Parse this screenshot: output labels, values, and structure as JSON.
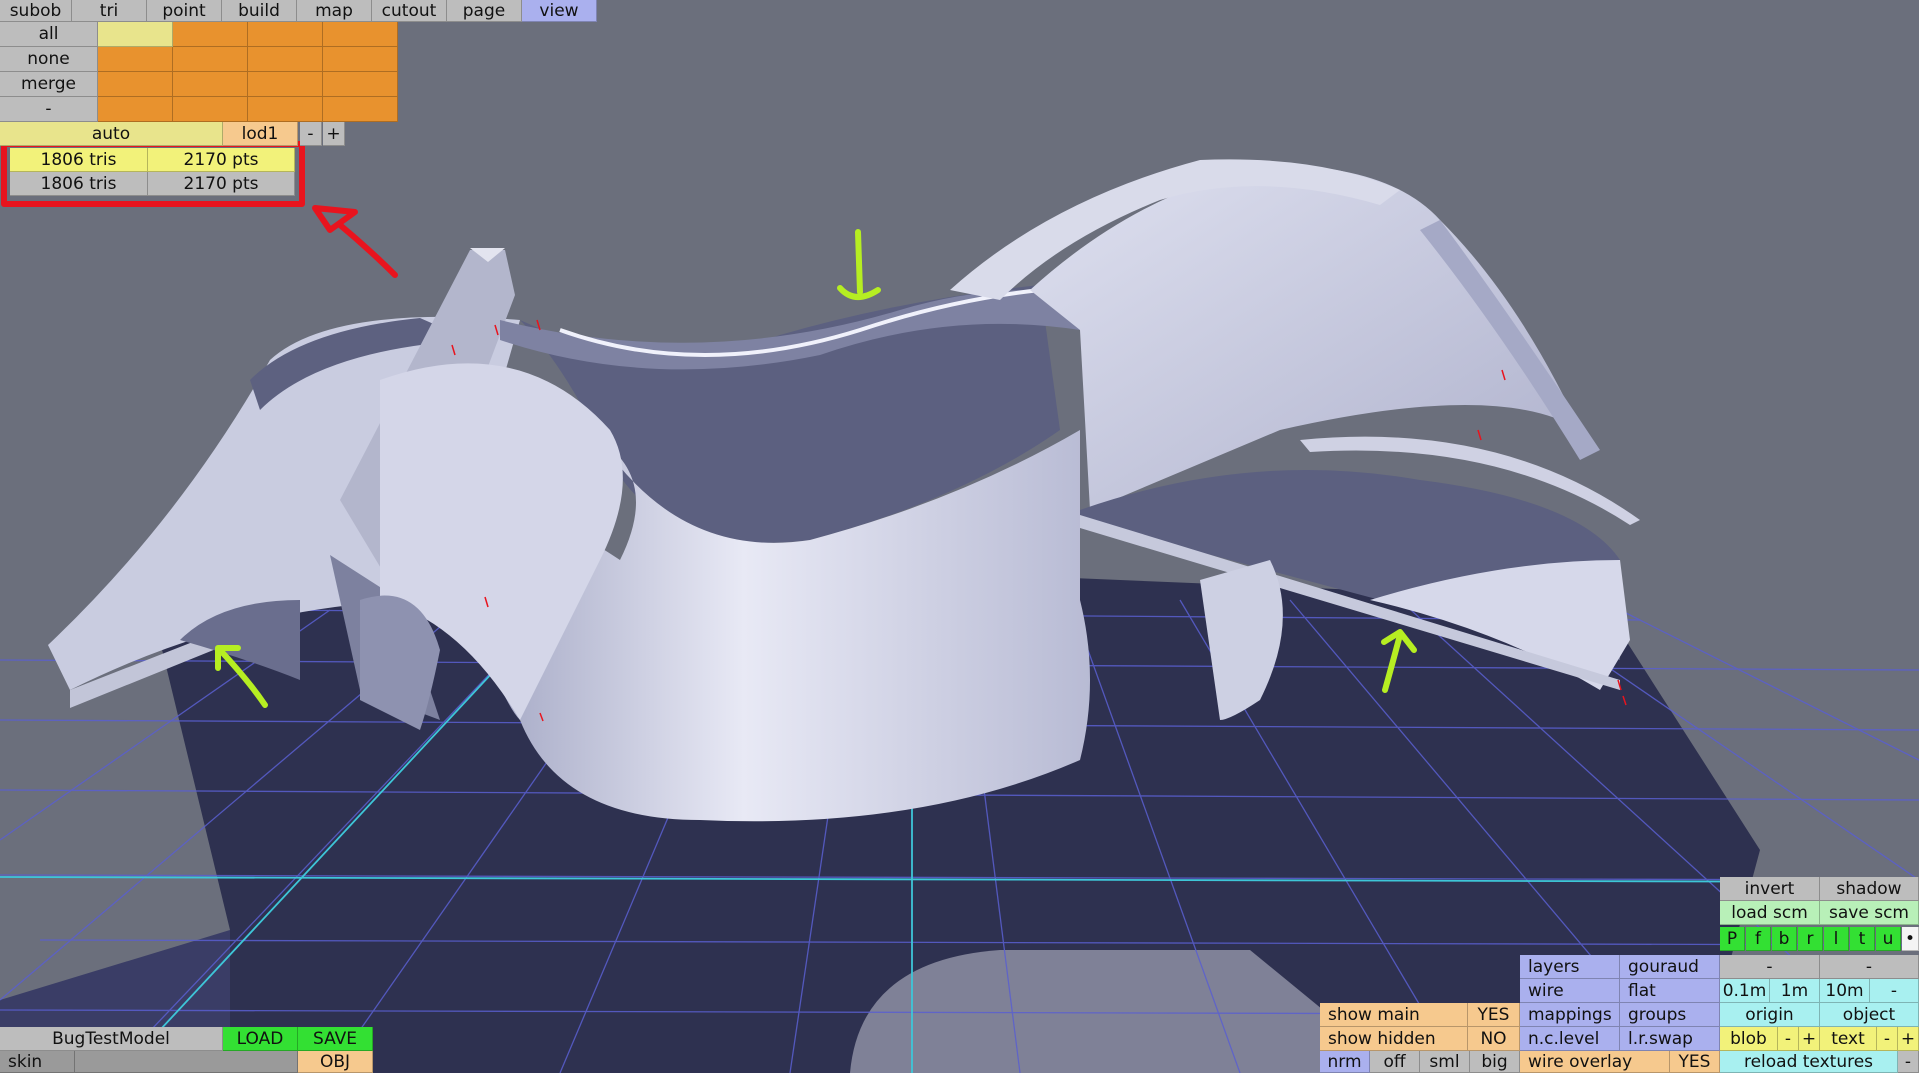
{
  "menu": {
    "tabs": [
      "subob",
      "tri",
      "point",
      "build",
      "map",
      "cutout",
      "page",
      "view"
    ],
    "active_tab": "view"
  },
  "selection_panel": {
    "rows": [
      "all",
      "none",
      "merge",
      "-"
    ]
  },
  "lod_bar": {
    "auto": "auto",
    "lod": "lod1",
    "minus": "-",
    "plus": "+"
  },
  "stats": [
    {
      "tris": "1806 tris",
      "pts": "2170 pts"
    },
    {
      "tris": "1806 tris",
      "pts": "2170 pts"
    }
  ],
  "file_bar": {
    "model_name": "BugTestModel",
    "load": "LOAD",
    "save": "SAVE",
    "skin": "skin",
    "format": "OBJ"
  },
  "display_panel": {
    "show_main": "show main",
    "show_main_val": "YES",
    "show_hidden": "show hidden",
    "show_hidden_val": "NO",
    "nrm": "nrm",
    "off": "off",
    "sml": "sml",
    "big": "big",
    "layers": "layers",
    "gouraud": "gouraud",
    "wire": "wire",
    "flat": "flat",
    "mappings": "mappings",
    "groups": "groups",
    "nc_level": "n.c.level",
    "lr_swap": "l.r.swap",
    "wire_overlay": "wire overlay",
    "wire_overlay_val": "YES"
  },
  "view_panel": {
    "invert": "invert",
    "shadow": "shadow",
    "load_scm": "load scm",
    "save_scm": "save scm",
    "views": [
      "P",
      "f",
      "b",
      "r",
      "l",
      "t",
      "u"
    ],
    "dot": "•",
    "dash1": "-",
    "dash2": "-",
    "grid": [
      "0.1m",
      "1m",
      "10m",
      "-"
    ],
    "origin": "origin",
    "object": "object",
    "blob": "blob",
    "blob_minus": "-",
    "blob_plus": "+",
    "text": "text",
    "text_minus": "-",
    "text_plus": "+",
    "reload_textures": "reload textures",
    "reload_minus": "-"
  },
  "colors": {
    "background": "#6b6f7c",
    "floor": "#2e3150",
    "grid": "#5a5fd0",
    "axis": "#3ec6d8",
    "model_light": "#cfd2e8",
    "model_dark": "#5c6080",
    "annotation_red": "#e8141e",
    "annotation_green": "#b6ee22"
  }
}
